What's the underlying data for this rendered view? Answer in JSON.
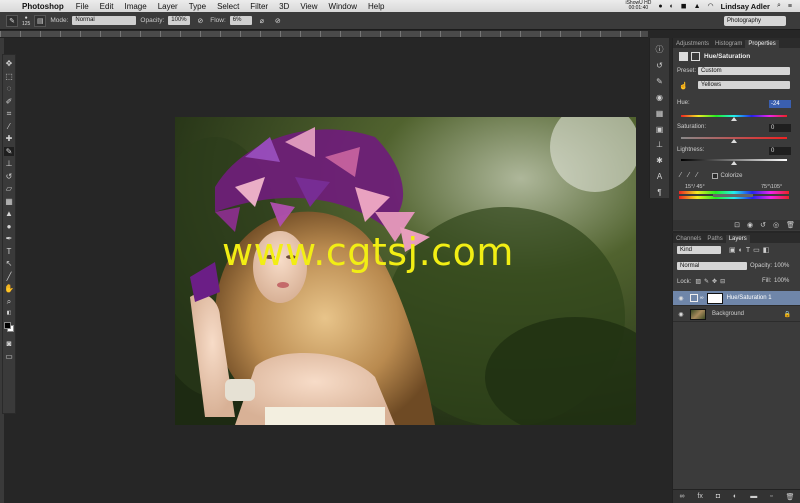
{
  "menubar": {
    "app_name": "Photoshop",
    "items": [
      "File",
      "Edit",
      "Image",
      "Layer",
      "Type",
      "Select",
      "Filter",
      "3D",
      "View",
      "Window",
      "Help"
    ],
    "clock_top": "iShowU HD",
    "clock_bottom": "00:01:40",
    "user": "Lindsay Adler"
  },
  "options_bar": {
    "brush_size": "125",
    "mode_label": "Mode:",
    "mode_value": "Normal",
    "opacity_label": "Opacity:",
    "opacity_value": "100%",
    "flow_label": "Flow:",
    "flow_value": "6%",
    "workspace": "Photography"
  },
  "canvas": {
    "watermark": "www.cgtsj.com"
  },
  "properties": {
    "tabs": [
      "Adjustments",
      "Histogram",
      "Properties"
    ],
    "active_tab": "Properties",
    "title": "Hue/Saturation",
    "preset_label": "Preset:",
    "preset_value": "Custom",
    "channel_value": "Yellows",
    "hue_label": "Hue:",
    "hue_value": "-24",
    "saturation_label": "Saturation:",
    "saturation_value": "0",
    "lightness_label": "Lightness:",
    "lightness_value": "0",
    "colorize_label": "Colorize",
    "range_left": "15°/ 45°",
    "range_right": "75°\\105°"
  },
  "layers_panel": {
    "tabs": [
      "Channels",
      "Paths",
      "Layers"
    ],
    "active_tab": "Layers",
    "filter_value": "Kind",
    "blend_mode": "Normal",
    "opacity_label": "Opacity:",
    "opacity_value": "100%",
    "lock_label": "Lock:",
    "fill_label": "Fill:",
    "fill_value": "100%",
    "layers": [
      {
        "name": "Hue/Saturation 1",
        "selected": true
      },
      {
        "name": "Background",
        "selected": false
      }
    ]
  },
  "colors": {
    "accent": "#6f86a9",
    "watermark": "#f2ee14"
  }
}
